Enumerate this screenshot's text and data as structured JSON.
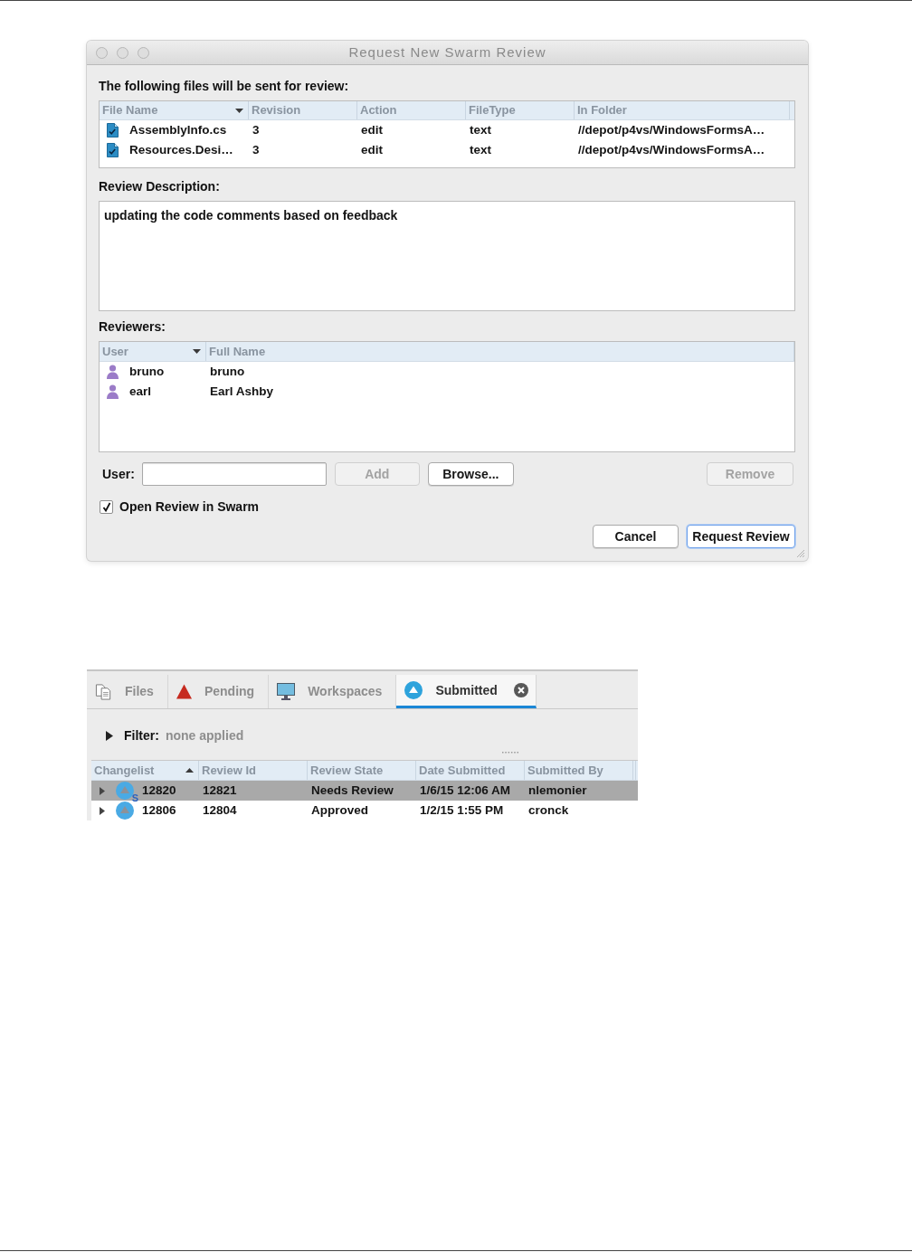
{
  "dialog": {
    "title": "Request New Swarm Review",
    "files": {
      "label": "The following files will be sent for review:",
      "columns": [
        {
          "label": "File Name",
          "sorted": true,
          "ascending": false
        },
        {
          "label": "Revision",
          "sorted": false
        },
        {
          "label": "Action",
          "sorted": false
        },
        {
          "label": "FileType",
          "sorted": false
        },
        {
          "label": "In Folder",
          "sorted": false
        }
      ],
      "rows": [
        {
          "cells": [
            "AssemblyInfo.cs",
            "3",
            "edit",
            "text",
            "//depot/p4vs/WindowsFormsA…"
          ]
        },
        {
          "cells": [
            "Resources.Desi…",
            "3",
            "edit",
            "text",
            "//depot/p4vs/WindowsFormsA…"
          ]
        }
      ]
    },
    "description": {
      "label": "Review Description:",
      "value": "updating the code comments based on feedback"
    },
    "reviewers": {
      "label": "Reviewers:",
      "columns": [
        {
          "label": "User",
          "sorted": true,
          "ascending": false
        },
        {
          "label": "Full Name",
          "sorted": false
        }
      ],
      "rows": [
        {
          "cells": [
            "bruno",
            "bruno"
          ]
        },
        {
          "cells": [
            "earl",
            "Earl Ashby"
          ]
        }
      ]
    },
    "user_field": {
      "label": "User:"
    },
    "reviewer_buttons": [
      {
        "label": "Add",
        "disabled": true
      },
      {
        "label": "Browse...",
        "disabled": false
      }
    ],
    "remove_button": {
      "label": "Remove",
      "disabled": true
    },
    "open_in_swarm": {
      "label": "Open Review in Swarm",
      "checked": true
    },
    "buttons": [
      {
        "label": "Cancel",
        "default": false
      },
      {
        "label": "Request Review",
        "default": true
      }
    ]
  },
  "panel": {
    "tabs": [
      {
        "label": "Files",
        "selected": false
      },
      {
        "label": "Pending",
        "selected": false
      },
      {
        "label": "Workspaces",
        "selected": false
      },
      {
        "label": "Submitted",
        "selected": true
      }
    ],
    "filter": {
      "label": "Filter:",
      "value": "none applied",
      "expanded": false
    },
    "table": {
      "columns": [
        {
          "label": "Changelist",
          "sorted": true,
          "ascending": true
        },
        {
          "label": "Review Id",
          "sorted": false
        },
        {
          "label": "Review State",
          "sorted": false
        },
        {
          "label": "Date Submitted",
          "sorted": false
        },
        {
          "label": "Submitted By",
          "sorted": false
        }
      ],
      "rows": [
        {
          "selected": true,
          "expanded": false,
          "badge": "S",
          "cells": [
            "12820",
            "12821",
            "Needs Review",
            "1/6/15 12:06 AM",
            "nlemonier"
          ]
        },
        {
          "selected": false,
          "expanded": false,
          "cells": [
            "12806",
            "12804",
            "Approved",
            "1/2/15 1:55 PM",
            "cronck"
          ]
        }
      ]
    }
  }
}
